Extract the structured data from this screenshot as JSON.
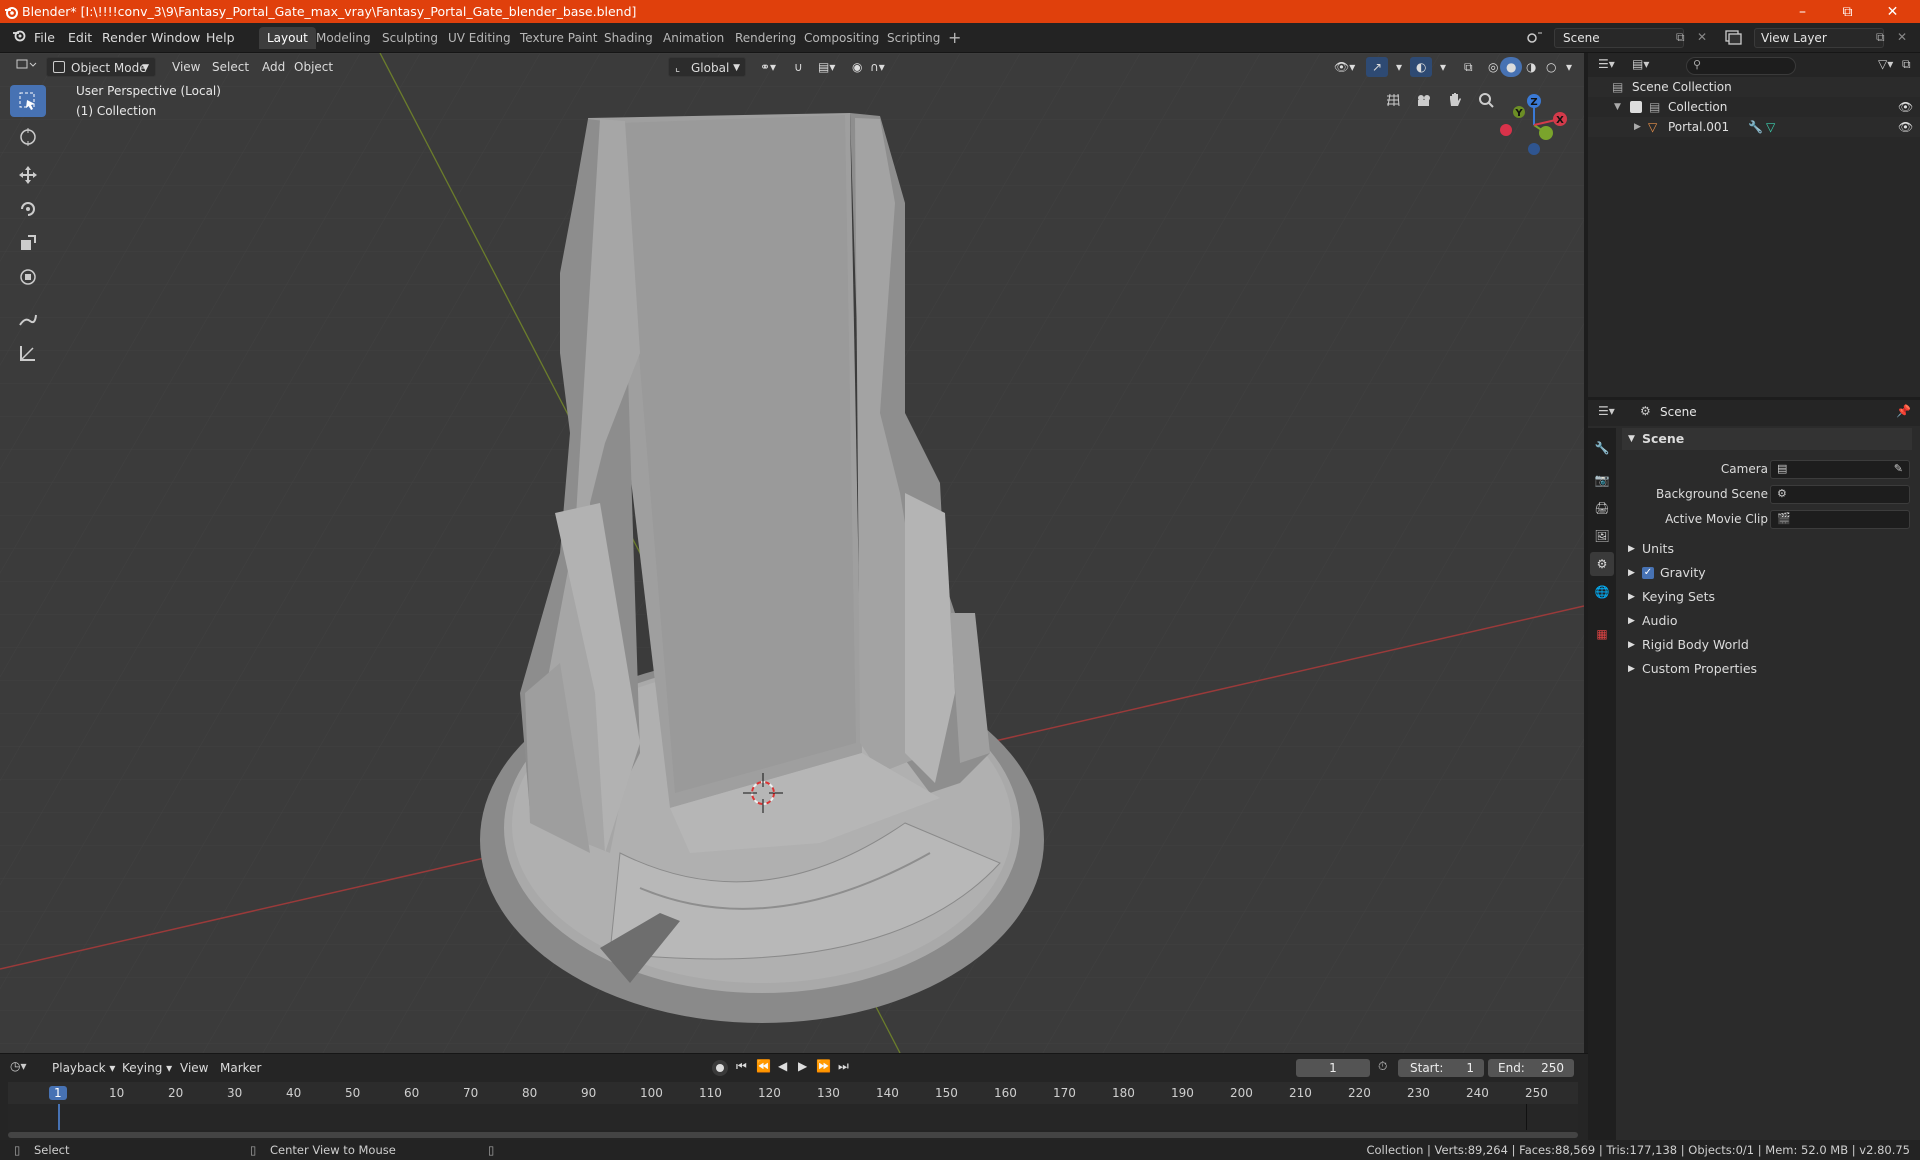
{
  "window": {
    "title": "Blender* [I:\\!!!!conv_3\\9\\Fantasy_Portal_Gate_max_vray\\Fantasy_Portal_Gate_blender_base.blend]",
    "accent": "#e0400c"
  },
  "menu": [
    "File",
    "Edit",
    "Render",
    "Window",
    "Help"
  ],
  "workspaces": [
    "Layout",
    "Modeling",
    "Sculpting",
    "UV Editing",
    "Texture Paint",
    "Shading",
    "Animation",
    "Rendering",
    "Compositing",
    "Scripting"
  ],
  "active_workspace": "Layout",
  "scene_field": "Scene",
  "view_layer_field": "View Layer",
  "viewport": {
    "mode": "Object Mode",
    "menus": [
      "View",
      "Select",
      "Add",
      "Object"
    ],
    "orientation": "Global",
    "info_line1": "User Perspective (Local)",
    "info_line2": "(1) Collection",
    "gizmo_axes": [
      "X",
      "Y",
      "Z"
    ]
  },
  "outliner": {
    "root": "Scene Collection",
    "collection": "Collection",
    "object": "Portal.001"
  },
  "properties": {
    "context": "Scene",
    "section": "Scene",
    "fields": [
      {
        "label": "Camera"
      },
      {
        "label": "Background Scene"
      },
      {
        "label": "Active Movie Clip"
      }
    ],
    "panels": [
      "Units",
      "Gravity",
      "Keying Sets",
      "Audio",
      "Rigid Body World",
      "Custom Properties"
    ]
  },
  "timeline": {
    "menus": [
      "Playback",
      "Keying",
      "View",
      "Marker"
    ],
    "current_frame": "1",
    "start_label": "Start:",
    "start": "1",
    "end_label": "End:",
    "end": "250",
    "ticks": [
      "1",
      "10",
      "20",
      "30",
      "40",
      "50",
      "60",
      "70",
      "80",
      "90",
      "100",
      "110",
      "120",
      "130",
      "140",
      "150",
      "160",
      "170",
      "180",
      "190",
      "200",
      "210",
      "220",
      "230",
      "240",
      "250"
    ]
  },
  "status": {
    "left": "Select",
    "middle": "Center View to Mouse",
    "right": "Collection | Verts:89,264 | Faces:88,569 | Tris:177,138 | Objects:0/1 | Mem: 52.0 MB | v2.80.75"
  }
}
